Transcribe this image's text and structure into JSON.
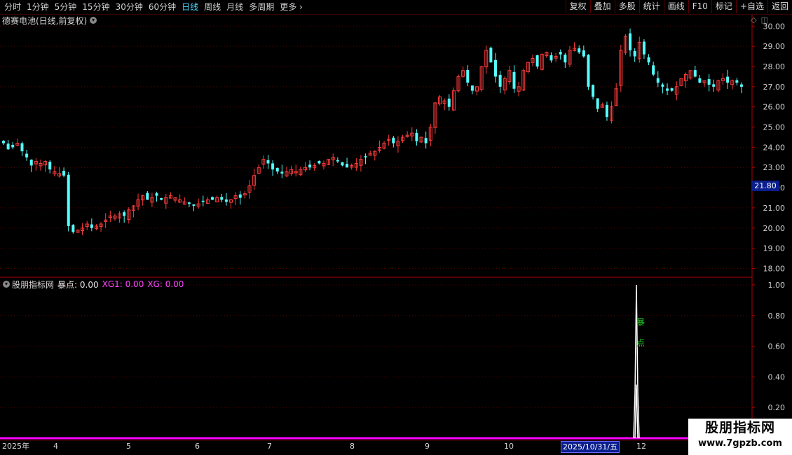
{
  "toolbar": {
    "periods": [
      "分时",
      "1分钟",
      "5分钟",
      "15分钟",
      "30分钟",
      "60分钟",
      "日线",
      "周线",
      "月线",
      "多周期",
      "更多"
    ],
    "active_period": "日线",
    "more_arrow": "›",
    "buttons": [
      "复权",
      "叠加",
      "多股",
      "统计",
      "画线",
      "F10",
      "标记",
      "+自选",
      "返回"
    ]
  },
  "chart_title": "德赛电池(日线,前复权)",
  "indicator": {
    "name": "股朋指标网",
    "v1_label": "暴点: 0.00",
    "v2_label": "XG1: 0.00",
    "v3_label": "XG: 0.00",
    "signal_chars": [
      "暴",
      "点"
    ]
  },
  "price_axis_labels": [
    "30.00",
    "29.00",
    "28.00",
    "27.00",
    "26.00",
    "25.00",
    "24.00",
    "23.00",
    "22.00",
    "21.00",
    "20.00",
    "19.00",
    "18.00"
  ],
  "indicator_axis_labels": [
    "1.00",
    "0.80",
    "0.60",
    "0.40",
    "0.20"
  ],
  "current_price_tag": "21.80",
  "x_labels": [
    "2025年",
    "4",
    "5",
    "6",
    "7",
    "8",
    "9",
    "10",
    "11",
    "12"
  ],
  "selected_date": "2025/10/31/五",
  "watermark": {
    "line1": "股朋指标网",
    "line2": "www.7gpzb.com"
  },
  "colors": {
    "up": "#ff3c3c",
    "down": "#54ffff",
    "grid": "#5a0000",
    "axis": "#b00000",
    "indicator_line": "#ff00ff",
    "signal": "#ffffff",
    "signal_text": "#22cc22"
  },
  "chart_data": [
    {
      "type": "candlestick",
      "title": "德赛电池(日线,前复权)",
      "ylim": [
        17.6,
        30.6
      ],
      "x_labels": [
        "2025年",
        "4",
        "5",
        "6",
        "7",
        "8",
        "9",
        "10",
        "11",
        "12"
      ],
      "close_trend": [
        24.2,
        23.9,
        24.0,
        24.2,
        23.8,
        23.5,
        23.1,
        23.3,
        23.2,
        23.3,
        22.9,
        22.8,
        22.7,
        22.6,
        20.1,
        19.8,
        19.9,
        20.0,
        20.2,
        20.0,
        20.1,
        20.2,
        20.4,
        20.6,
        20.6,
        20.7,
        20.6,
        20.9,
        21.1,
        21.4,
        21.6,
        21.4,
        21.5,
        21.6,
        21.4,
        21.5,
        21.6,
        21.5,
        21.4,
        21.3,
        21.2,
        21.1,
        21.2,
        21.3,
        21.4,
        21.4,
        21.5,
        21.4,
        21.3,
        21.4,
        21.6,
        21.5,
        21.7,
        22.1,
        22.6,
        23.0,
        23.4,
        23.2,
        22.9,
        22.8,
        22.7,
        22.8,
        22.9,
        22.8,
        22.9,
        23.0,
        23.0,
        23.1,
        23.2,
        23.2,
        23.4,
        23.5,
        23.3,
        23.1,
        23.0,
        23.1,
        23.2,
        23.4,
        23.5,
        23.7,
        23.8,
        24.0,
        24.2,
        24.4,
        24.2,
        24.3,
        24.5,
        24.6,
        24.7,
        24.3,
        24.5,
        24.2,
        25.0,
        26.2,
        26.5,
        26.3,
        26.0,
        26.8,
        27.5,
        27.8,
        27.2,
        26.8,
        27.0,
        28.0,
        28.8,
        28.2,
        27.5,
        27.0,
        27.4,
        27.8,
        26.9,
        27.0,
        27.8,
        28.2,
        28.4,
        28.0,
        28.6,
        28.7,
        28.3,
        28.5,
        28.6,
        28.2,
        28.8,
        28.9,
        28.7,
        28.5,
        27.0,
        26.5,
        25.9,
        26.1,
        25.5,
        26.0,
        26.9,
        28.8,
        29.5,
        28.8,
        28.5,
        29.2,
        28.6,
        28.2,
        27.6,
        27.2,
        27.0,
        26.8,
        26.8,
        27.0,
        27.4,
        27.6,
        27.8,
        27.5,
        27.2,
        27.3,
        27.1,
        27.0,
        27.3,
        27.4,
        27.2,
        27.3,
        27.2,
        27.0
      ],
      "overlay_line": 21.8
    },
    {
      "type": "line",
      "series": [
        {
          "name": "暴点",
          "values": [
            0,
            0,
            0,
            0,
            0,
            0,
            0,
            0,
            0,
            0,
            0,
            0,
            0,
            0,
            1,
            0,
            0,
            0,
            0,
            0
          ]
        }
      ],
      "signal_at": "2025-11",
      "ylim": [
        0,
        1.0
      ]
    }
  ]
}
